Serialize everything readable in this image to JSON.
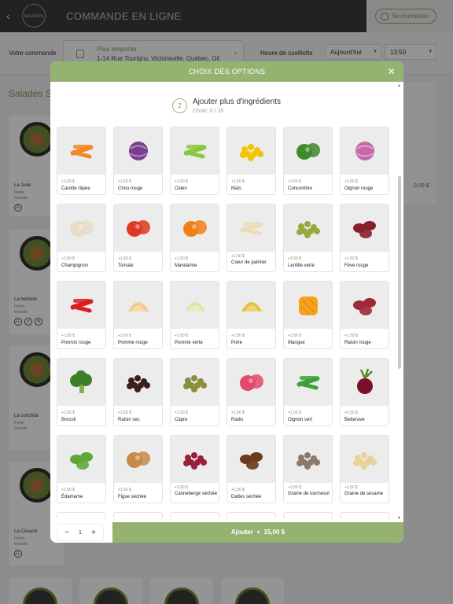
{
  "app": {
    "title": "COMMANDE EN LIGNE",
    "logo_text": "SELEPPE",
    "login_label": "Se connecter"
  },
  "order_bar": {
    "label": "Votre commande",
    "pickup_type": "Pour emporter",
    "pickup_address": "1-14 Rue Tourigny, Victoriaville, Québec, G6...",
    "time_label": "Heure de cueillette",
    "day_value": "Aujourd'hui",
    "time_value": "13:50"
  },
  "menu": {
    "section_title": "Salades Sig",
    "items": [
      {
        "name": "La June",
        "sizes": [
          "Petite",
          "Grande"
        ]
      },
      {
        "name": "La berbère",
        "sizes": [
          "Petite",
          "Grande"
        ]
      },
      {
        "name": "La conchita",
        "sizes": [
          "Petite",
          "Grande"
        ]
      },
      {
        "name": "La Césarre",
        "sizes": [
          "Petite",
          "Grande"
        ]
      }
    ],
    "right_price": "0,00 $"
  },
  "modal": {
    "title": "CHOIX DES OPTIONS",
    "step_number": "2",
    "step_title": "Ajouter plus d'ingrédients",
    "step_subtitle": "Choix: 0 / 10",
    "options": [
      {
        "name": "Carotte râpée",
        "price": "+1,50 $",
        "icon": "carrot",
        "color": "#f08a24"
      },
      {
        "name": "Chou rouge",
        "price": "+1,50 $",
        "icon": "cabbage",
        "color": "#7b3f8f"
      },
      {
        "name": "Céleri",
        "price": "+1,50 $",
        "icon": "celery",
        "color": "#8cc63f"
      },
      {
        "name": "Maïs",
        "price": "+1,50 $",
        "icon": "corn",
        "color": "#f5c400"
      },
      {
        "name": "Concombre",
        "price": "+1,50 $",
        "icon": "cucumber",
        "color": "#3f8a2c"
      },
      {
        "name": "Oignon rouge",
        "price": "+1,50 $",
        "icon": "onion",
        "color": "#c46aa6"
      },
      {
        "name": "Champignon",
        "price": "+1,50 $",
        "icon": "mushroom",
        "color": "#e8dcc4"
      },
      {
        "name": "Tomate",
        "price": "+1,50 $",
        "icon": "tomato",
        "color": "#e03a22"
      },
      {
        "name": "Mandarine",
        "price": "+1,50 $",
        "icon": "mandarin",
        "color": "#f07f1a"
      },
      {
        "name": "Cœur de palmier",
        "price": "+1,50 $",
        "icon": "palm-heart",
        "color": "#ecdcb8"
      },
      {
        "name": "Lentille verte",
        "price": "+1,50 $",
        "icon": "lentil",
        "color": "#9aa83a"
      },
      {
        "name": "Fève rouge",
        "price": "+1,50 $",
        "icon": "bean",
        "color": "#8a1f2a"
      },
      {
        "name": "Poivron rouge",
        "price": "+1,50 $",
        "icon": "pepper",
        "color": "#d91f1f"
      },
      {
        "name": "Pomme rouge",
        "price": "+1,50 $",
        "icon": "apple",
        "color": "#f2c98a"
      },
      {
        "name": "Pomme verte",
        "price": "+1,50 $",
        "icon": "apple",
        "color": "#d7e8a8"
      },
      {
        "name": "Poire",
        "price": "+1,50 $",
        "icon": "pear",
        "color": "#e3c23a"
      },
      {
        "name": "Mangue",
        "price": "+1,50 $",
        "icon": "mango",
        "color": "#f5a21c"
      },
      {
        "name": "Raisin rouge",
        "price": "+1,50 $",
        "icon": "grape",
        "color": "#a0273a"
      },
      {
        "name": "Brocoli",
        "price": "+1,50 $",
        "icon": "broccoli",
        "color": "#3f7d2a"
      },
      {
        "name": "Raisin sec",
        "price": "+1,50 $",
        "icon": "raisin",
        "color": "#3a1f1a"
      },
      {
        "name": "Câpre",
        "price": "+1,50 $",
        "icon": "caper",
        "color": "#8a8e3a"
      },
      {
        "name": "Radis",
        "price": "+1,50 $",
        "icon": "radish",
        "color": "#e24a6a"
      },
      {
        "name": "Oignon vert",
        "price": "+1,50 $",
        "icon": "green-onion",
        "color": "#3fa03a"
      },
      {
        "name": "Betterave",
        "price": "+1,50 $",
        "icon": "beet",
        "color": "#7a0f2a"
      },
      {
        "name": "Édamame",
        "price": "+1,50 $",
        "icon": "edamame",
        "color": "#5ea83a"
      },
      {
        "name": "Figue séchée",
        "price": "+1,50 $",
        "icon": "fig",
        "color": "#c8884a"
      },
      {
        "name": "Canneberge séchée",
        "price": "+1,50 $",
        "icon": "cranberry",
        "color": "#9a1f3a"
      },
      {
        "name": "Dattes séchée",
        "price": "+1,50 $",
        "icon": "date",
        "color": "#6a3a1a"
      },
      {
        "name": "Graine de tournesol",
        "price": "+1,50 $",
        "icon": "seed",
        "color": "#8a7a6a"
      },
      {
        "name": "Graine de sésame",
        "price": "+1,50 $",
        "icon": "sesame",
        "color": "#e8d29a"
      }
    ],
    "quantity": "1",
    "add_label": "Ajouter",
    "add_price": "15,00 $"
  },
  "colors": {
    "accent": "#94b36f",
    "accent_text": "#7a9a5b",
    "topbar": "#3b3b3b"
  }
}
